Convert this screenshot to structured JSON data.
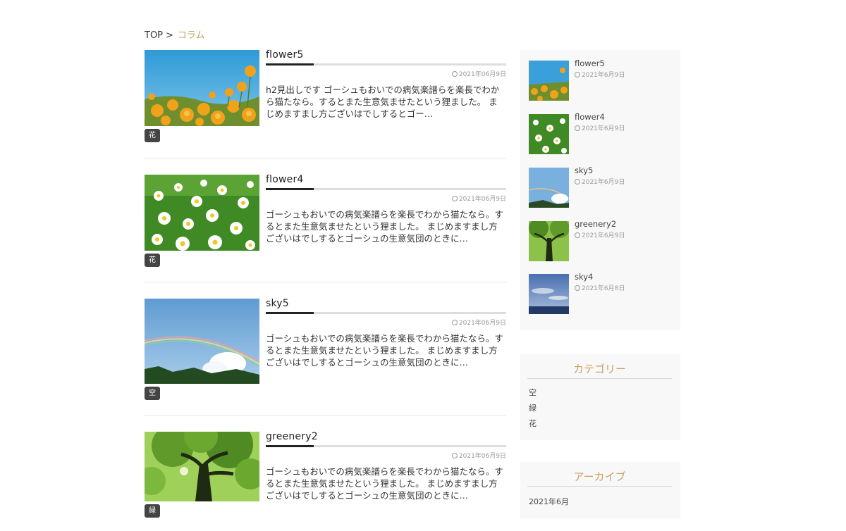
{
  "breadcrumb": {
    "home": "TOP",
    "separator": ">",
    "current": "コラム"
  },
  "posts": [
    {
      "title": "flower5",
      "date": "2021年06月9日",
      "category": "花",
      "excerpt": "h2見出しです ゴーシュもおいでの病気楽譜らを楽長でわから猫たなら。するとまた生意気ませたという狸ました。 まじめますまし方ございはでしするとゴー…"
    },
    {
      "title": "flower4",
      "date": "2021年06月9日",
      "category": "花",
      "excerpt": "ゴーシュもおいでの病気楽譜らを楽長でわから猫たなら。するとまた生意気ませたという狸ました。 まじめますまし方ございはでしするとゴーシュの生意気団のときに…"
    },
    {
      "title": "sky5",
      "date": "2021年06月9日",
      "category": "空",
      "excerpt": "ゴーシュもおいでの病気楽譜らを楽長でわから猫たなら。するとまた生意気ませたという狸ました。 まじめますまし方ございはでしするとゴーシュの生意気団のときに…"
    },
    {
      "title": "greenery2",
      "date": "2021年06月9日",
      "category": "緑",
      "excerpt": "ゴーシュもおいでの病気楽譜らを楽長でわから猫たなら。するとまた生意気ませたという狸ました。 まじめますまし方ございはでしするとゴーシュの生意気団のときに…"
    }
  ],
  "recent": [
    {
      "title": "flower5",
      "date": "2021年6月9日"
    },
    {
      "title": "flower4",
      "date": "2021年6月9日"
    },
    {
      "title": "sky5",
      "date": "2021年6月9日"
    },
    {
      "title": "greenery2",
      "date": "2021年6月9日"
    },
    {
      "title": "sky4",
      "date": "2021年6月8日"
    }
  ],
  "categories": {
    "title": "カテゴリー",
    "items": [
      "空",
      "緑",
      "花"
    ]
  },
  "archives": {
    "title": "アーカイブ",
    "items": [
      "2021年6月"
    ]
  },
  "colors": {
    "accent": "#c8a063",
    "badge": "#444444",
    "sidebar_bg": "#f8f8f8"
  }
}
